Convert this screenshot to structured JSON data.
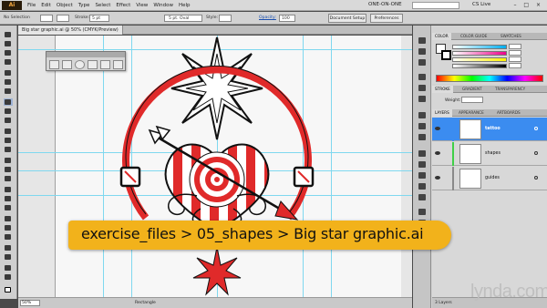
{
  "app": {
    "logo": "Ai",
    "menu": [
      "File",
      "Edit",
      "Object",
      "Type",
      "Select",
      "Effect",
      "View",
      "Window",
      "Help"
    ],
    "workspace": "ONE-ON-ONE",
    "cslive": "CS Live",
    "window_controls": "– □ ×"
  },
  "control_bar": {
    "selection": "No Selection",
    "stroke_label": "Stroke:",
    "stroke_value": "5 pt",
    "brush": "5 pt. Oval",
    "style_label": "Style:",
    "opacity_label": "Opacity:",
    "opacity_value": "100",
    "doc_setup": "Document Setup",
    "preferences": "Preferences"
  },
  "document": {
    "tab_title": "Big star graphic.ai @ 50% (CMYK/Preview)"
  },
  "panels": {
    "color_tabs": [
      "COLOR",
      "COLOR GUIDE",
      "SWATCHES"
    ],
    "stroke_tabs": [
      "STROKE",
      "GRADIENT",
      "TRANSPARENCY"
    ],
    "stroke_weight_label": "Weight:",
    "layers_tabs": [
      "LAYERS",
      "APPEARANCE",
      "ARTBOARDS"
    ],
    "layers": [
      {
        "name": "tattoo",
        "selected": true,
        "color": "#3b8cf0"
      },
      {
        "name": "shapes",
        "selected": false,
        "color": "#3fcf47"
      },
      {
        "name": "guides",
        "selected": false,
        "color": "#8a8a8a"
      }
    ],
    "layers_footer": "3 Layers"
  },
  "status_bar": {
    "zoom": "50%",
    "tool": "Rectangle"
  },
  "overlay": {
    "path": "exercise_files > 05_shapes > Big star graphic.ai"
  },
  "brand": {
    "watermark": "lynda.com"
  },
  "colors": {
    "accent_red": "#e02a2a",
    "banner_yellow": "#f2b21b",
    "selection_blue": "#3b8cf0"
  }
}
